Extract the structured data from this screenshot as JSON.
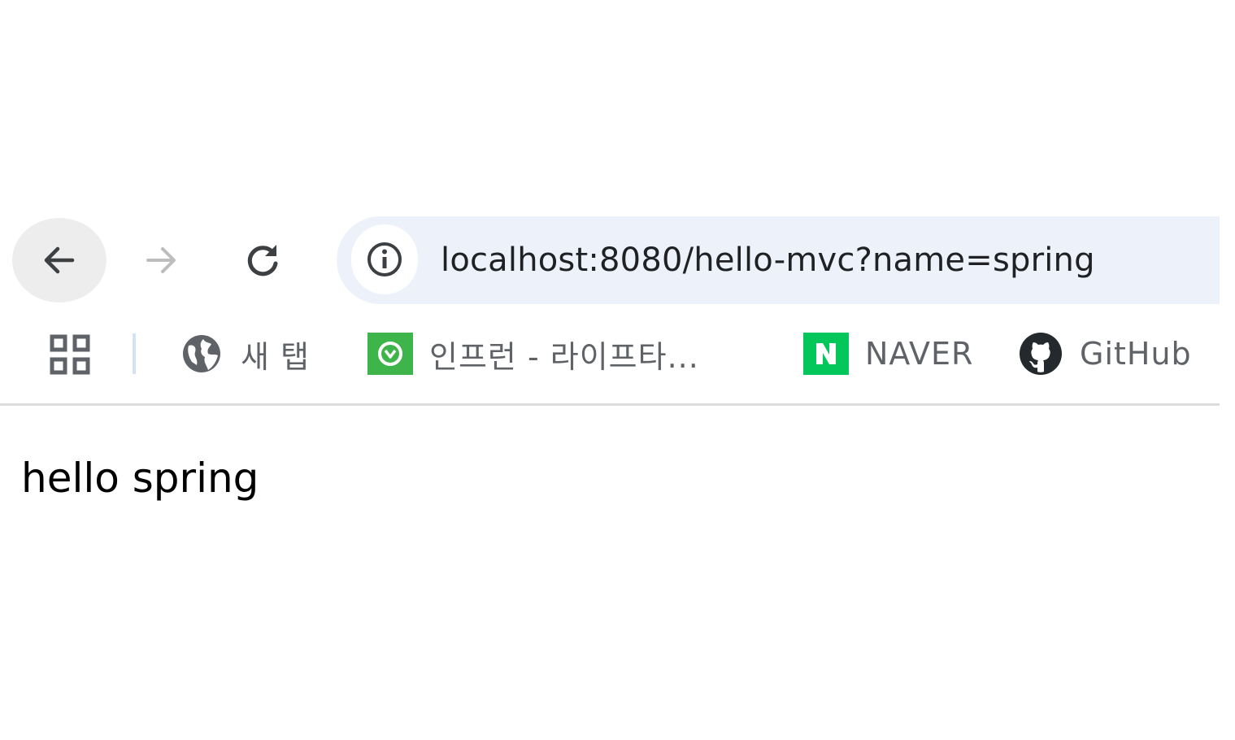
{
  "toolbar": {
    "back_icon": "arrow-left-icon",
    "forward_icon": "arrow-right-icon",
    "reload_icon": "reload-icon",
    "site_info_icon": "info-icon",
    "url": "localhost:8080/hello-mvc?name=spring"
  },
  "bookmarks": {
    "apps_icon": "apps-grid-icon",
    "items": [
      {
        "label": "새 탭",
        "icon": "globe-icon",
        "color": "#5f6368"
      },
      {
        "label": "인프런 - 라이프타...",
        "icon": "inflearn-icon",
        "color": "#3eb54a"
      },
      {
        "label": "NAVER",
        "icon": "naver-icon",
        "color": "#03c75a"
      },
      {
        "label": "GitHub",
        "icon": "github-icon",
        "color": "#24292e"
      }
    ]
  },
  "page": {
    "text": "hello spring"
  },
  "colors": {
    "omnibox_bg": "#edf1fa",
    "back_button_bg": "#ededed",
    "divider": "#dcdcdc"
  }
}
